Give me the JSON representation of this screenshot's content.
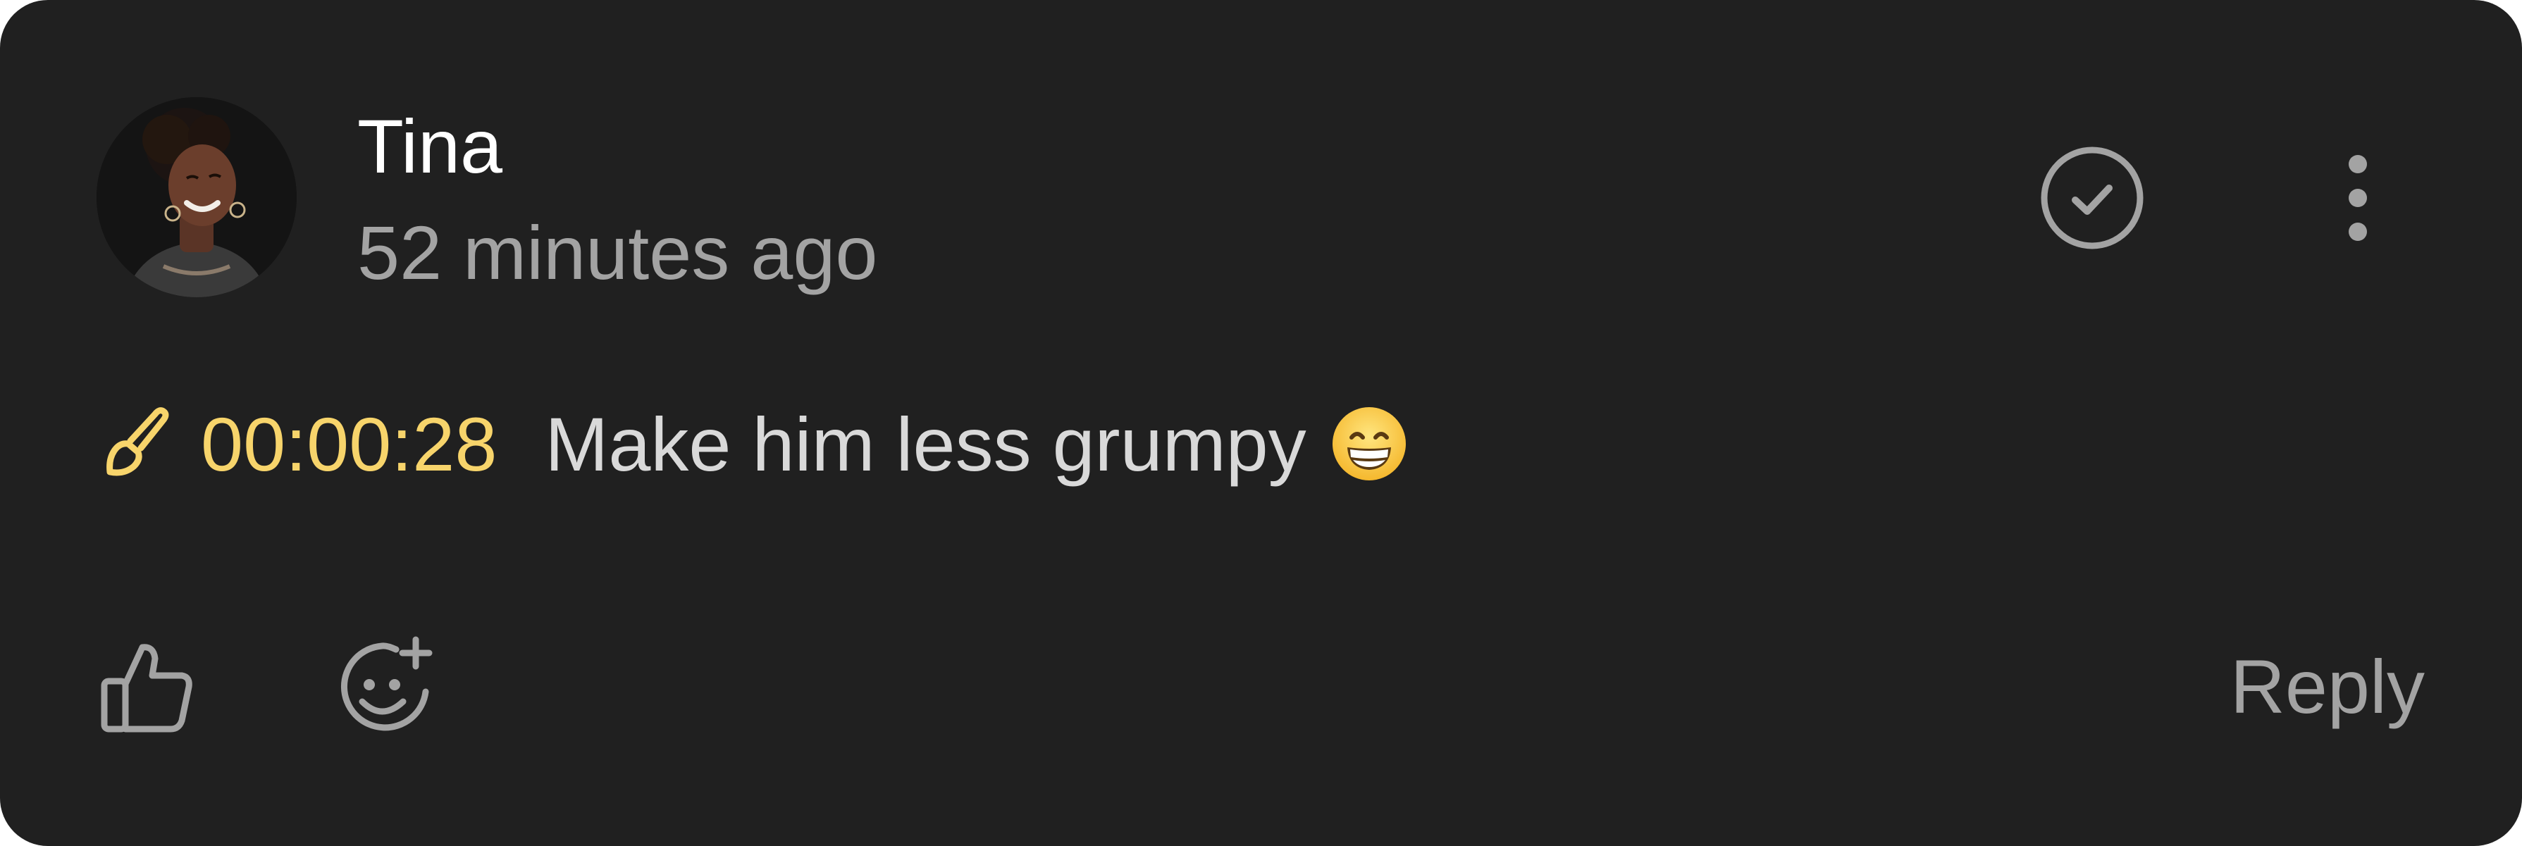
{
  "comment": {
    "author": "Tina",
    "time_ago": "52 minutes ago",
    "timestamp": "00:00:28",
    "text": "Make him less grumpy",
    "emoji": "grinning-face-emoji"
  },
  "actions": {
    "reply_label": "Reply",
    "resolve_icon": "check-circle-icon",
    "more_icon": "more-vertical-icon",
    "like_icon": "thumbs-up-icon",
    "react_icon": "add-reaction-icon",
    "annotation_icon": "paintbrush-icon"
  },
  "colors": {
    "card_background": "#202020",
    "timestamp_accent": "#f7d46b",
    "muted_text": "#a3a3a3",
    "primary_text": "#ffffff"
  }
}
